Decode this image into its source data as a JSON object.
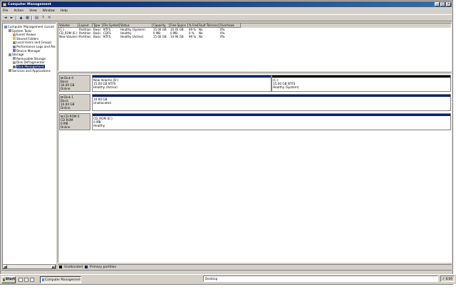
{
  "window": {
    "title": "Computer Management"
  },
  "title_buttons": {
    "minimize": "_",
    "maximize": "□",
    "close": "×"
  },
  "menu": [
    {
      "label": "File"
    },
    {
      "label": "Action"
    },
    {
      "label": "View"
    },
    {
      "label": "Window"
    },
    {
      "label": "Help"
    }
  ],
  "toolbar": {
    "icons": [
      "back-icon",
      "forward-icon",
      "up-icon",
      "show-hide-tree-icon",
      "properties-icon",
      "help-icon",
      "refresh-icon",
      "export-icon"
    ]
  },
  "tree": [
    {
      "label": "Computer Management (Local)",
      "depth": 0,
      "icon": "computer-icon"
    },
    {
      "label": "System Tools",
      "depth": 1,
      "icon": "tools-icon"
    },
    {
      "label": "Event Viewer",
      "depth": 2,
      "icon": "event-icon"
    },
    {
      "label": "Shared Folders",
      "depth": 2,
      "icon": "folder-icon"
    },
    {
      "label": "Local Users and Groups",
      "depth": 2,
      "icon": "users-icon"
    },
    {
      "label": "Performance Logs and Alerts",
      "depth": 2,
      "icon": "perf-icon"
    },
    {
      "label": "Device Manager",
      "depth": 2,
      "icon": "device-icon"
    },
    {
      "label": "Storage",
      "depth": 1,
      "icon": "storage-icon"
    },
    {
      "label": "Removable Storage",
      "depth": 2,
      "icon": "removable-icon"
    },
    {
      "label": "Disk Defragmenter",
      "depth": 2,
      "icon": "defrag-icon"
    },
    {
      "label": "Disk Management",
      "depth": 2,
      "icon": "disk-icon",
      "selected": true
    },
    {
      "label": "Services and Applications",
      "depth": 1,
      "icon": "services-icon"
    }
  ],
  "list": {
    "columns": [
      "Volume",
      "Layout",
      "Type",
      "File System",
      "Status",
      "Capacity",
      "Free Space",
      "% Free",
      "Fault Tolerance",
      "Overhead"
    ],
    "rows": [
      [
        "(C:)",
        "Partition",
        "Basic",
        "NTFS",
        "Healthy (System)",
        "15.00 GB",
        "10.45 GB",
        "69 %",
        "No",
        "0%"
      ],
      [
        "CD_ROM (E:)",
        "Partition",
        "Basic",
        "CDFS",
        "Healthy",
        "0 MB",
        "0 MB",
        "0 %",
        "No",
        "0%"
      ],
      [
        "New Volume (D:)",
        "Partition",
        "Basic",
        "NTFS",
        "Healthy (Active)",
        "15.00 GB",
        "14.96 GB",
        "99 %",
        "No",
        "0%"
      ]
    ]
  },
  "disks": [
    {
      "name": "Disk 0",
      "type": "Basic",
      "size": "30.00 GB",
      "status": "Online",
      "parts": [
        {
          "lines": [
            "New Volume (D:)",
            "15.00 GB NTFS",
            "Healthy (Active)"
          ],
          "bar": "primary"
        },
        {
          "lines": [
            "(C:)",
            "15.00 GB NTFS",
            "Healthy (System)"
          ],
          "bar": "unalloc"
        }
      ]
    },
    {
      "name": "Disk 1",
      "type": "Basic",
      "size": "10.00 GB",
      "status": "Online",
      "parts": [
        {
          "lines": [
            "10.00 GB",
            "Unallocated"
          ],
          "bar": "primary"
        }
      ]
    },
    {
      "name": "CD-ROM 0",
      "type": "CD-ROM",
      "size": "0 MB",
      "status": "Online",
      "parts": [
        {
          "lines": [
            "CD_ROM (E:)",
            "0 MB",
            "Healthy"
          ],
          "bar": "primary"
        }
      ]
    }
  ],
  "legend": [
    {
      "label": "Unallocated",
      "color": "#000000"
    },
    {
      "label": "Primary partition",
      "color": "#0a246a"
    }
  ],
  "taskbar": {
    "start": "Start",
    "task": "Computer Management",
    "address": "Desktop",
    "clock": "6:00"
  }
}
